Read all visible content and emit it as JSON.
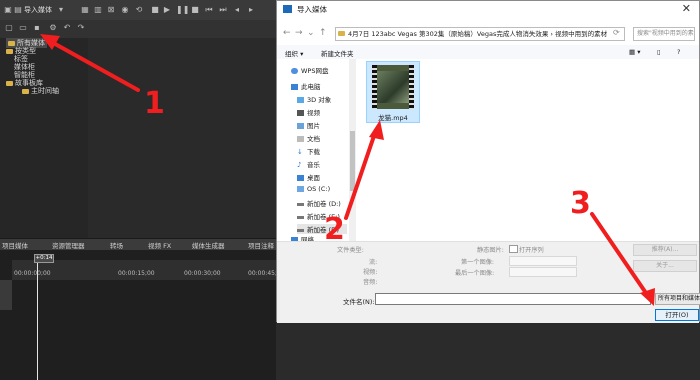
{
  "vegas": {
    "import_media": "导入媒体",
    "tree": {
      "all_media": "所有媒体",
      "by_type": "按类型",
      "tags": "标签",
      "media_bins": "媒体柜",
      "smart_bins": "智能柜",
      "storyboard_bins": "故事板库",
      "main_timeline": "主时间轴"
    },
    "tabs": [
      "项目媒体",
      "资源管理器",
      "转场",
      "视频 FX",
      "媒体生成器",
      "项目注释"
    ],
    "timecodes": [
      "00:00:00;00",
      "00:00:15;00",
      "00:00:30;00",
      "00:00:45;00"
    ],
    "cursor_time": "+0:14"
  },
  "dialog": {
    "title": "导入媒体",
    "address": "4月7日 123abc Vegas 第302集（原始稿）Vegas完成人物消失效果  ›  视频中用到的素材",
    "search_placeholder": "搜索\"视频中用到的素材\"",
    "organize": "组织 ▾",
    "new_folder": "新建文件夹",
    "nav_items": [
      "WPS网盘",
      "此电脑",
      "3D 对象",
      "视频",
      "图片",
      "文档",
      "下载",
      "音乐",
      "桌面",
      "OS (C:)",
      "新加卷 (D:)",
      "新加卷 (E:)",
      "新加卷 (F:)",
      "网络"
    ],
    "file": {
      "name": "龙猫.mp4"
    },
    "props": {
      "file_type": "文件类型:",
      "stream": "流:",
      "video": "视频:",
      "audio": "音频:",
      "still_seq": "静态图片:",
      "open_seq": "打开序列",
      "first_image": "第一个图像:",
      "last_image": "最后一个图像:"
    },
    "buttons": {
      "recommend": "推荐(A)...",
      "about": "关于..."
    },
    "filename_label": "文件名(N):",
    "filter": "所有项目和媒体",
    "open": "打开(O)"
  },
  "annotations": [
    "1",
    "2",
    "3"
  ],
  "colors": {
    "arrow": "#f01e1e",
    "selection": "#cce8ff",
    "accent": "#0078d7"
  }
}
